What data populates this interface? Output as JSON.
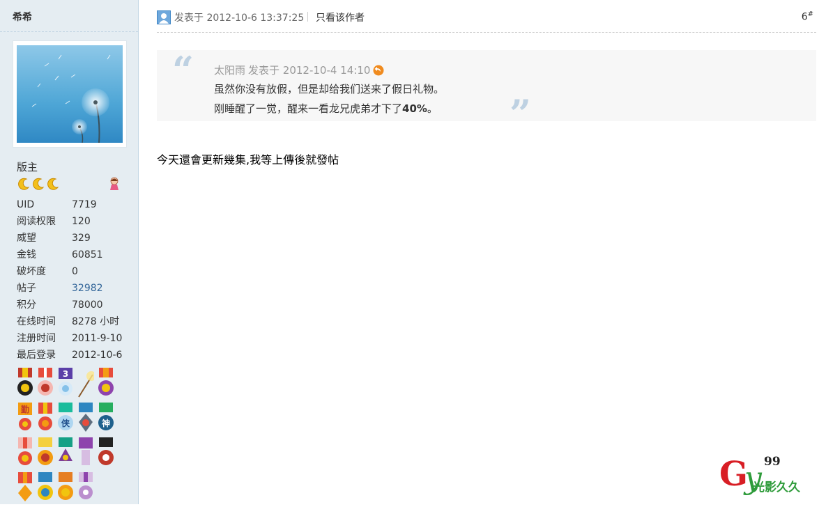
{
  "sidebar": {
    "username": "希希",
    "group": "版主",
    "stars": 3,
    "profile": [
      {
        "key": "UID",
        "value": "7719"
      },
      {
        "key": "阅读权限",
        "value": "120"
      },
      {
        "key": "威望",
        "value": "329"
      },
      {
        "key": "金钱",
        "value": "60851"
      },
      {
        "key": "破坏度",
        "value": "0"
      },
      {
        "key": "帖子",
        "value": "32982"
      },
      {
        "key": "积分",
        "value": "78000"
      },
      {
        "key": "在线时间",
        "value": "8278 小时"
      },
      {
        "key": "注册时间",
        "value": "2011-9-10"
      },
      {
        "key": "最后登录",
        "value": "2012-10-6"
      }
    ],
    "medal_labels": {
      "m3": "3",
      "m6": "勤",
      "m8": "侠",
      "m10": "神"
    }
  },
  "post": {
    "posted_at": "发表于 2012-10-6 13:37:25",
    "author_only": "只看该作者",
    "floor": "6",
    "floor_sup": "#",
    "quote": {
      "author": "太阳雨",
      "posted": "发表于 2012-10-4 14:10",
      "line1": "虽然你没有放假，但是却给我们送来了假日礼物。",
      "line2_prefix": "刚睡醒了一觉，醒来一看龙兄虎弟才下了",
      "line2_bold": "40%",
      "line2_suffix": "。"
    },
    "body": "今天還會更新幾集,我等上傳後就發帖"
  },
  "watermark": {
    "letter_g": "G",
    "letter_y": "y",
    "num": "99",
    "text": "光影久久"
  },
  "colors": {
    "sidebar_bg": "#e5edf2",
    "link": "#336699",
    "quote_bg": "#f7f7f7",
    "quote_mark": "#bed1e2",
    "watermark_red": "#d81e25",
    "watermark_green": "#2e9b3a"
  }
}
